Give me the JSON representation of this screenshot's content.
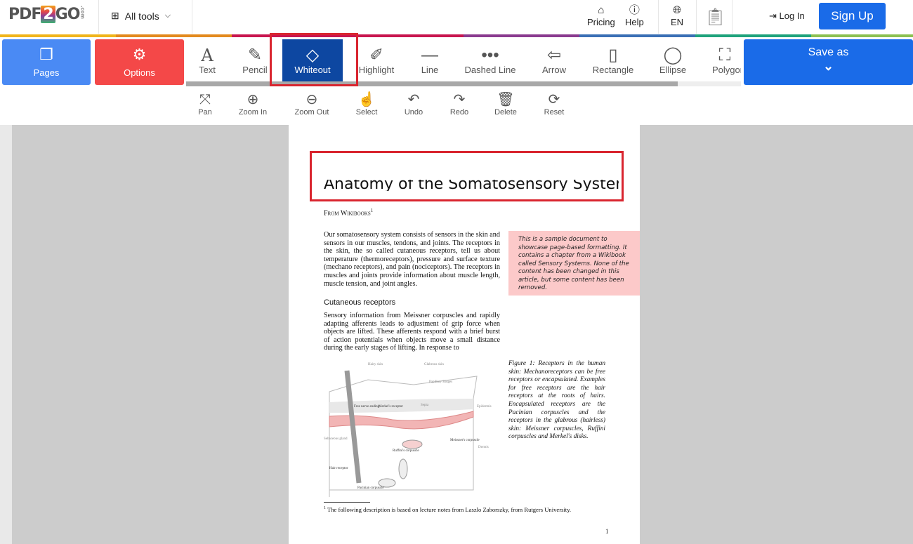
{
  "header": {
    "logo_text": "PDF2GO",
    "logo_domain": ".com",
    "all_tools": "All tools",
    "pricing": "Pricing",
    "help": "Help",
    "language": "EN",
    "login": "Log In",
    "signup": "Sign Up"
  },
  "toolbar": {
    "pages": "Pages",
    "options": "Options",
    "tools": [
      {
        "label": "Text"
      },
      {
        "label": "Pencil"
      },
      {
        "label": "Whiteout",
        "active": true
      },
      {
        "label": "Highlight"
      },
      {
        "label": "Line"
      },
      {
        "label": "Dashed Line"
      },
      {
        "label": "Arrow"
      },
      {
        "label": "Rectangle"
      },
      {
        "label": "Ellipse"
      },
      {
        "label": "Polygon"
      }
    ],
    "save_as": "Save as",
    "secondary": [
      "Pan",
      "Zoom In",
      "Zoom Out",
      "Select",
      "Undo",
      "Redo",
      "Delete",
      "Reset"
    ]
  },
  "colors": {
    "primary": "#1a6be8",
    "pages": "#4a8af4",
    "options": "#f44848",
    "active_tool": "#0d47a1",
    "annotation": "#d9252f",
    "note_bg": "#fcc9c9"
  },
  "document": {
    "title": "Anatomy of the Somatosensory System",
    "byline": "From Wikibooks",
    "byline_sup": "1",
    "intro": "Our somatosensory system consists of sensors in the skin and sensors in our muscles, tendons, and joints. The receptors in the skin, the so called cutaneous receptors, tell us about temperature (thermoreceptors), pressure and surface texture (mechano receptors), and pain (nociceptors). The receptors in muscles and joints provide information about muscle length, muscle tension, and joint angles.",
    "note": "This is a sample document to showcase page-based formatting. It contains a chapter from a Wikibook called Sensory Systems. None of the content has been changed in this article, but some content has been removed.",
    "section_heading": "Cutaneous receptors",
    "section_text": "Sensory information from Meissner corpuscles and rapidly adapting afferents leads to adjustment of grip force when objects are lifted. These afferents respond with a brief burst of action potentials when objects move a small distance during the early stages of lifting. In response to",
    "figure_caption": "Figure 1: Receptors in the human skin: Mechanoreceptors can be free receptors or encapsulated. Examples for free receptors are the hair receptors at the roots of hairs. Encapsulated receptors are the Pacinian corpuscles and the receptors in the glabrous (hairless) skin: Meissner corpuscles, Ruffini corpuscles and Merkel's disks.",
    "figure_labels": {
      "hairy": "Hairy skin",
      "glabrous": "Glabrous skin",
      "ridges": "Papillary Ridges",
      "epidermis": "Epidermis",
      "dermis": "Dermis",
      "free_nerve": "Free nerve ending",
      "merkel": "Merkel's receptor",
      "septa": "Septa",
      "sebaceous": "Sebaceous gland",
      "ruffini": "Ruffini's corpuscle",
      "meissner": "Meissner's corpuscle",
      "hair_receptor": "Hair receptor",
      "pacinian": "Pacinian corpuscle"
    },
    "footnote_mark": "1",
    "footnote": "The following description is based on lecture notes from Laszlo Zaborszky, from Rutgers University.",
    "page_number": "1"
  }
}
